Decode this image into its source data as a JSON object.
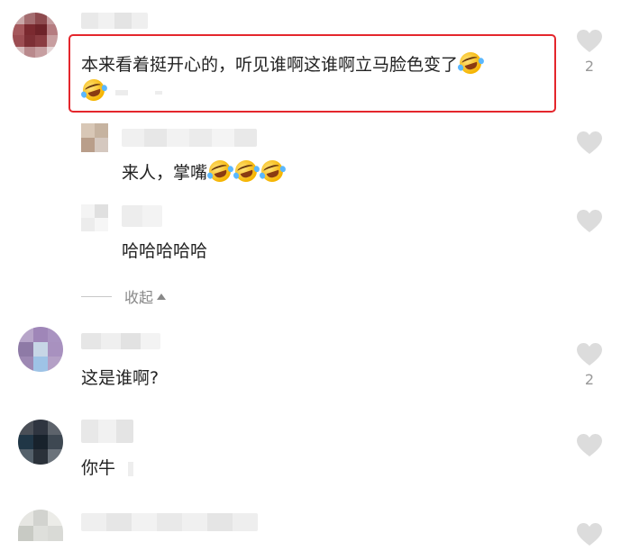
{
  "comments": {
    "c1": {
      "text_line1": "本来看着挺开心的，听见谁啊这谁啊立马脸色变了",
      "likes": "2"
    },
    "r1": {
      "text": "来人，掌嘴"
    },
    "r2": {
      "text": "哈哈哈哈哈"
    },
    "collapse_label": "收起",
    "c2": {
      "text": "这是谁啊?",
      "likes": "2"
    },
    "c3": {
      "text": "你牛"
    }
  },
  "colors": {
    "highlight": "#e4262c",
    "heart": "#dcdcdc",
    "muted_text": "#888888"
  },
  "icons": {
    "like": "heart-icon",
    "emoji": "rofl-emoji-icon",
    "collapse": "caret-up-icon"
  }
}
